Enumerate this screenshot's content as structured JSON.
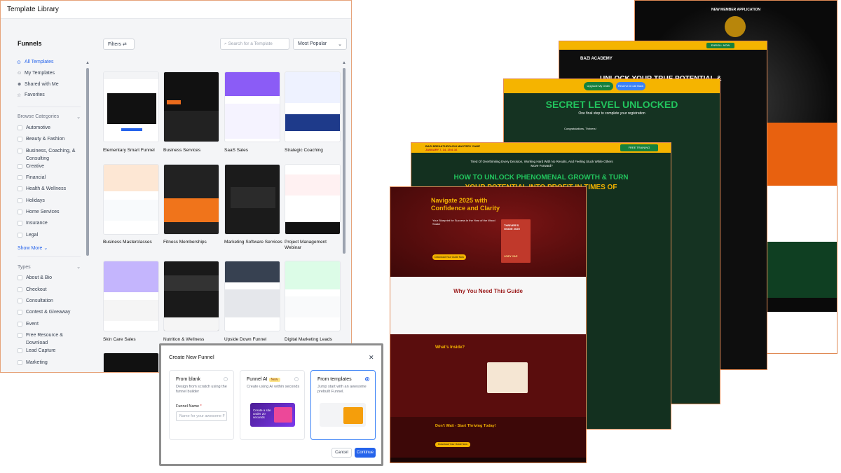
{
  "library": {
    "title": "Template Library",
    "section_title": "Funnels",
    "nav": [
      {
        "label": "All Templates",
        "icon": "grid-icon"
      },
      {
        "label": "My Templates",
        "icon": "user-icon"
      },
      {
        "label": "Shared with Me",
        "icon": "users-icon"
      },
      {
        "label": "Favorites",
        "icon": "star-icon"
      }
    ],
    "browse_categories_label": "Browse Categories",
    "categories": [
      "Automotive",
      "Beauty & Fashion",
      "Business, Coaching, & Consulting",
      "Creative",
      "Financial",
      "Health & Wellness",
      "Holidays",
      "Home Services",
      "Insurance",
      "Legal"
    ],
    "show_more": "Show More",
    "types_label": "Types",
    "types": [
      "About & Bio",
      "Checkout",
      "Consultation",
      "Contest & Giveaway",
      "Event",
      "Free Resource & Download",
      "Lead Capture",
      "Marketing"
    ],
    "filters_label": "Filters",
    "search_placeholder": "Search for a Template",
    "sort_selected": "Most Popular",
    "templates": [
      {
        "name": "Elementary Smart Funnel"
      },
      {
        "name": "Business Services"
      },
      {
        "name": "SaaS Sales"
      },
      {
        "name": "Strategic Coaching"
      },
      {
        "name": "Business Masterclasses"
      },
      {
        "name": "Fitness Memberships"
      },
      {
        "name": "Marketing Software Services"
      },
      {
        "name": "Project Management Webinar"
      },
      {
        "name": "Skin Care Sales"
      },
      {
        "name": "Nutrition & Wellness"
      },
      {
        "name": "Upside Down Funnel"
      },
      {
        "name": "Digital Marketing Leads"
      }
    ]
  },
  "dialog": {
    "title": "Create New Funnel",
    "options": [
      {
        "title": "From blank",
        "desc": "Design from scratch using the funnel builder"
      },
      {
        "title": "Funnel AI",
        "badge": "New",
        "desc": "Create using AI within seconds"
      },
      {
        "title": "From templates",
        "desc": "Jump start with an awesome prebuilt Funnel."
      }
    ],
    "name_label": "Funnel Name",
    "name_placeholder": "Name for your awesome F",
    "ai_preview_text": "Create a site under 20 seconds",
    "cancel": "Cancel",
    "continue": "Continue"
  },
  "pages": {
    "p5_title": "NEW MEMBER APPLICATION",
    "p4_brand": "BAZI ACADEMY",
    "p4_headline": "UNLOCK YOUR TRUE POTENTIAL &",
    "p4_cta": "ENROLL NOW",
    "p3_btn1": "Upgrade My Order",
    "p3_btn2": "Reserve A Call Back",
    "p3_headline": "SECRET LEVEL UNLOCKED",
    "p3_sub": "One final step to complete your registration",
    "p3_body": "Congratulations, Thrivers!",
    "p2_top": "BAZI BREAKTHROUGH MASTERY CAMP",
    "p2_dates": "JANUARY 7, 14, 15 & 16",
    "p2_cta": "FREE TRAINING",
    "p2_lead": "Tired Of Overthinking Every Decision, Working Hard With No Results, And Feeling Stuck While Others Move Forward?",
    "p2_headline1": "HOW TO UNLOCK PHENOMENAL GROWTH & TURN",
    "p2_headline2": "YOUR POTENTIAL INTO PROFIT IN TIMES OF",
    "p1_headline": "Navigate 2025 with Confidence and Clarity",
    "p1_sub": "Your Blueprint for Success in the Year of the Wood Snake",
    "p1_btn": "Download Your Guide Now",
    "p1_book_title": "THRIVER'S GUIDE 2025",
    "p1_book_author": "JOEY YAP",
    "p1_why": "Why You Need This Guide",
    "p1_inside": "What's Inside?",
    "p1_dont_wait": "Don't Wait - Start Thriving Today!",
    "p1_btn2": "Download Your Guide Now"
  },
  "colors": {
    "accent": "#2563eb",
    "gold": "#f5b400",
    "maroon": "#5a0d0d",
    "green_dark": "#153322",
    "orange": "#e8610f"
  }
}
